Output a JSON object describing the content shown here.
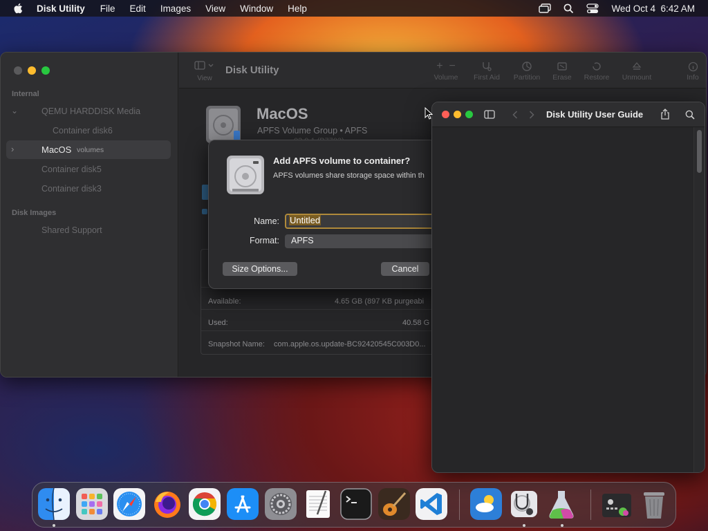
{
  "menubar": {
    "app_name": "Disk Utility",
    "items": [
      "File",
      "Edit",
      "Images",
      "View",
      "Window",
      "Help"
    ],
    "clock": "Wed Oct 4  6:42 AM",
    "status_icons": [
      "screen-mirroring-icon",
      "spotlight-search-icon",
      "control-center-icon"
    ]
  },
  "disk_utility": {
    "title": "Disk Utility",
    "view_label": "View",
    "toolbar": [
      "Volume",
      "First Aid",
      "Partition",
      "Erase",
      "Restore",
      "Unmount",
      "Info"
    ],
    "sidebar": {
      "internal_header": "Internal",
      "items": [
        {
          "label": "QEMU HARDDISK Media"
        },
        {
          "label": "Container disk6"
        },
        {
          "label": "MacOS",
          "sub": "volumes"
        },
        {
          "label": "Container disk5"
        },
        {
          "label": "Container disk3"
        }
      ],
      "images_header": "Disk Images",
      "image_items": [
        "Shared Support"
      ]
    },
    "volume": {
      "name": "MacOS",
      "type": "APFS Volume Group • APFS",
      "partial_line": "…03.0.1 (B7703)"
    },
    "info": {
      "available_label": "Available:",
      "available_value": "4.65 GB (897 KB purgeabi",
      "used_label": "Used:",
      "used_value": "40.58 G",
      "snapshot_label": "Snapshot Name:",
      "snapshot_value": "com.apple.os.update-BC92420545C003D0..."
    }
  },
  "dialog": {
    "heading": "Add APFS volume to container?",
    "description": "APFS volumes share storage space within th",
    "name_label": "Name:",
    "name_value": "Untitled",
    "format_label": "Format:",
    "format_value": "APFS",
    "size_options": "Size Options...",
    "cancel": "Cancel"
  },
  "help_viewer": {
    "title": "Disk Utility User Guide"
  },
  "dock": {
    "apps": [
      "Finder",
      "Launchpad",
      "Safari",
      "Firefox",
      "Chrome",
      "App Store",
      "System Settings",
      "TextEdit",
      "Terminal",
      "GarageBand",
      "Visual Studio Code",
      "Weather",
      "Disk Utility",
      "Image Tool",
      "Downloads Stack",
      "Trash"
    ]
  },
  "colors": {
    "accent_focus": "#b08a3a",
    "close": "#ff5f57",
    "minimize": "#febc2e",
    "maximize": "#28c840"
  }
}
